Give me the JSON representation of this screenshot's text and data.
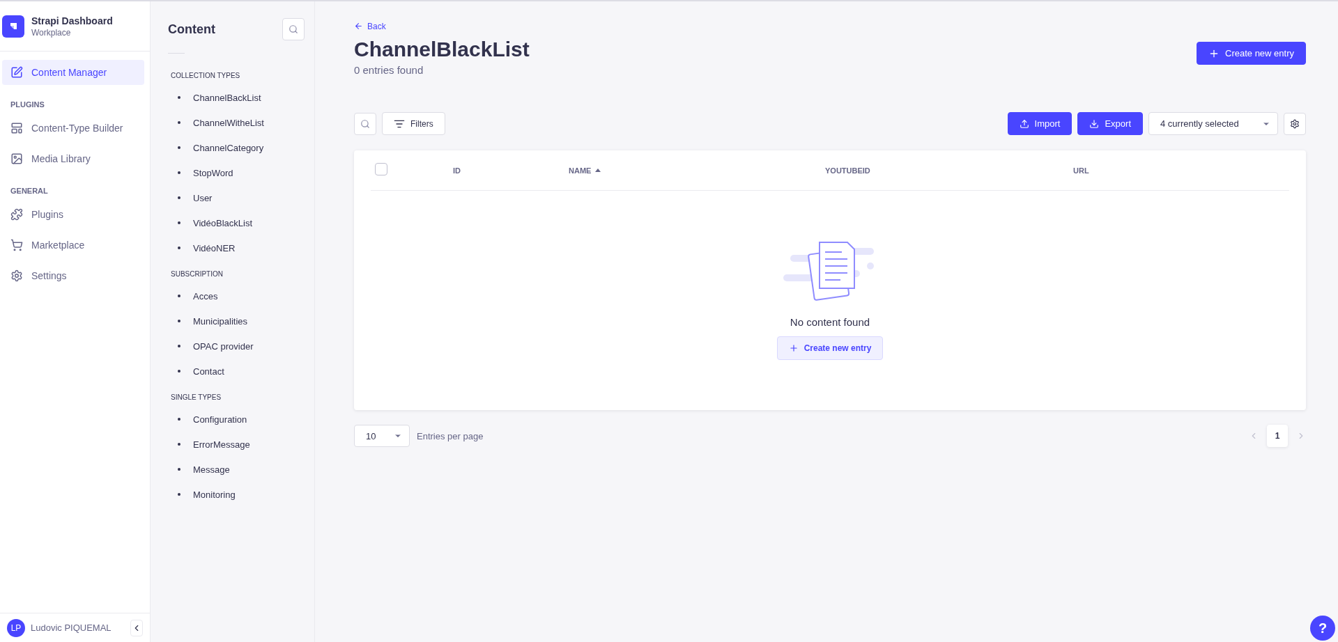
{
  "brand": {
    "title": "Strapi Dashboard",
    "subtitle": "Workplace"
  },
  "nav": {
    "items": [
      {
        "kind": "item",
        "label": "Content Manager",
        "selected": true
      },
      {
        "kind": "section",
        "label": "PLUGINS"
      },
      {
        "kind": "item",
        "label": "Content-Type Builder",
        "selected": false
      },
      {
        "kind": "item",
        "label": "Media Library",
        "selected": false
      },
      {
        "kind": "section",
        "label": "GENERAL"
      },
      {
        "kind": "item",
        "label": "Plugins",
        "selected": false
      },
      {
        "kind": "item",
        "label": "Marketplace",
        "selected": false
      },
      {
        "kind": "item",
        "label": "Settings",
        "selected": false
      }
    ],
    "user": {
      "initials": "LP",
      "name": "Ludovic PIQUEMAL"
    }
  },
  "content_sidebar": {
    "title": "Content",
    "groups": [
      {
        "label": "COLLECTION TYPES",
        "items": [
          "ChannelBackList",
          "ChannelWitheList",
          "ChannelCategory",
          "StopWord",
          "User",
          "VidéoBlackList",
          "VidéoNER"
        ]
      },
      {
        "label": "SUBSCRIPTION",
        "items": [
          "Acces",
          "Municipalities",
          "OPAC provider",
          "Contact"
        ]
      },
      {
        "label": "SINGLE TYPES",
        "items": [
          "Configuration",
          "ErrorMessage",
          "Message",
          "Monitoring"
        ]
      }
    ]
  },
  "header": {
    "back": "Back",
    "title": "ChannelBlackList",
    "subtitle": "0 entries found",
    "create_button": "Create new entry"
  },
  "toolbar": {
    "filters": "Filters",
    "import": "Import",
    "export": "Export",
    "columns_select": "4 currently selected"
  },
  "table": {
    "select_all_checked": false,
    "columns": [
      {
        "label": "ID",
        "sorted": false
      },
      {
        "label": "NAME",
        "sorted": true
      },
      {
        "label": "YOUTUBEID",
        "sorted": false
      },
      {
        "label": "URL",
        "sorted": false
      }
    ],
    "empty_state": {
      "message": "No content found",
      "button": "Create new entry"
    }
  },
  "pagination": {
    "page_size": "10",
    "page_size_label": "Entries per page",
    "pages": [
      {
        "label": "1",
        "selected": true
      }
    ],
    "prev_disabled": true,
    "next_disabled": true
  },
  "help_button": "?"
}
